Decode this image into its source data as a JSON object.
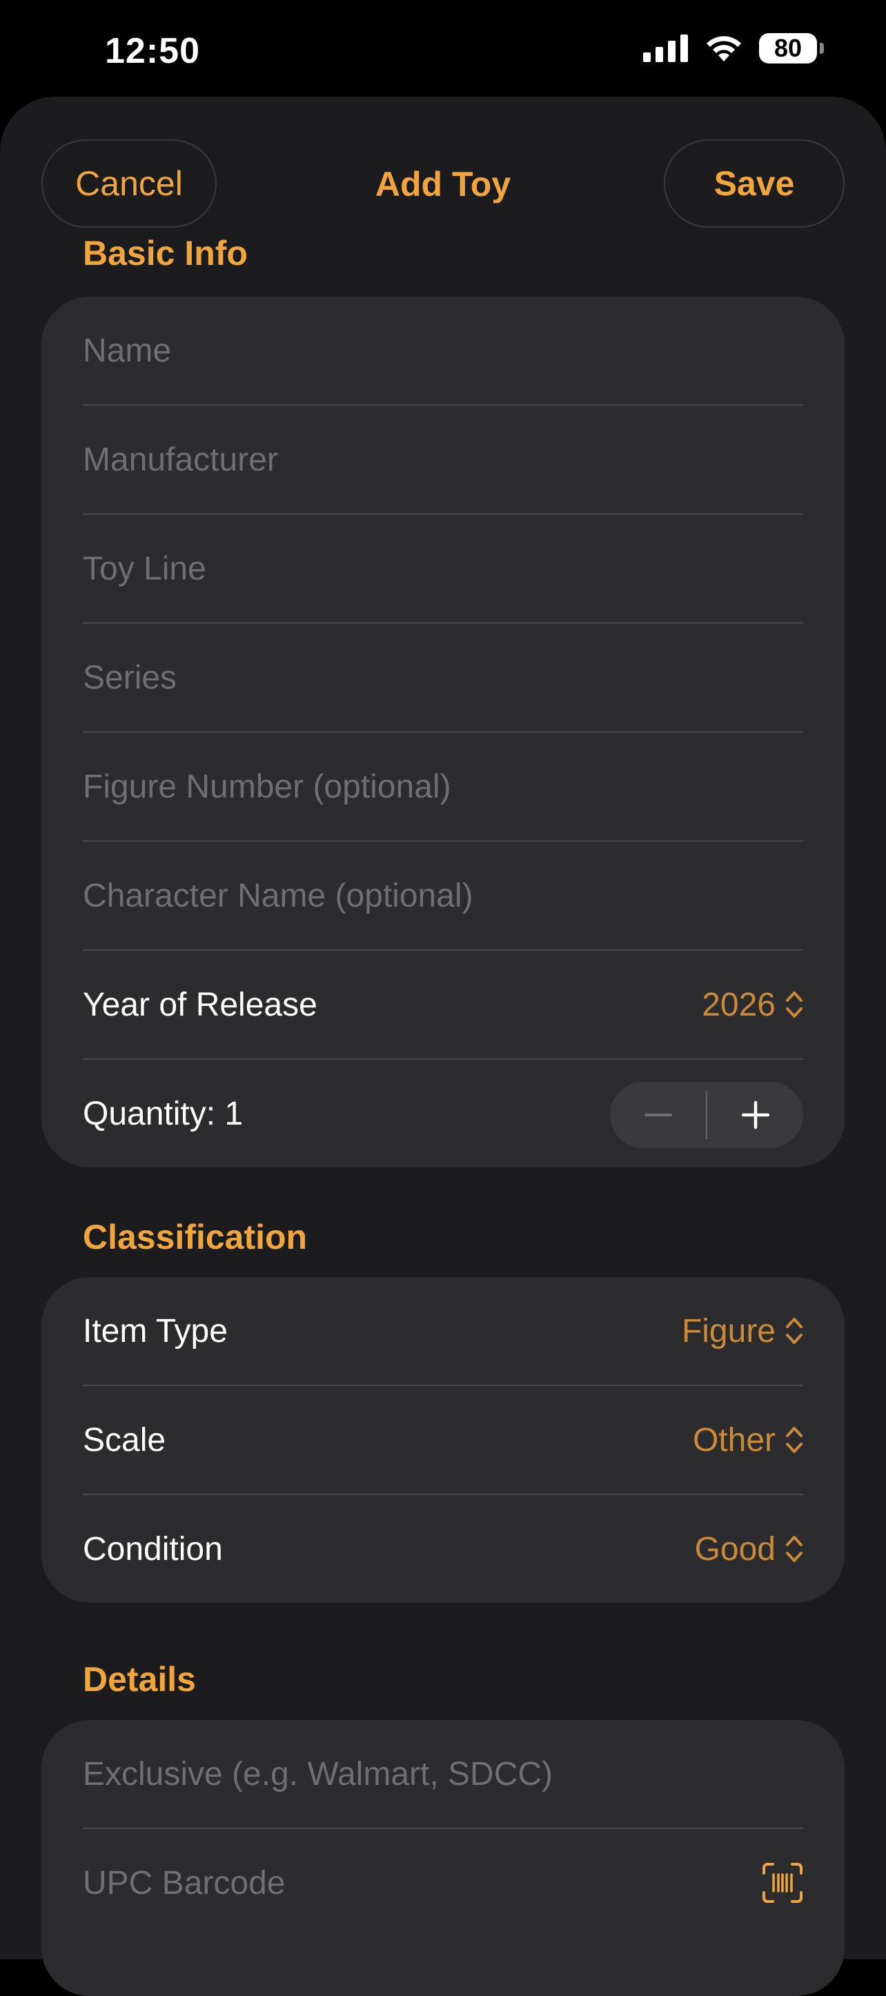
{
  "status": {
    "time": "12:50",
    "battery": "80",
    "icons": [
      "cellular-signal-icon",
      "wifi-icon",
      "battery-icon"
    ]
  },
  "nav": {
    "cancel": "Cancel",
    "title": "Add Toy",
    "save": "Save"
  },
  "basic_info": {
    "header": "Basic Info",
    "name_placeholder": "Name",
    "manufacturer_placeholder": "Manufacturer",
    "toy_line_placeholder": "Toy Line",
    "series_placeholder": "Series",
    "figure_number_placeholder": "Figure Number (optional)",
    "character_name_placeholder": "Character Name (optional)",
    "year_label": "Year of Release",
    "year_value": "2026",
    "quantity_label": "Quantity: 1"
  },
  "classification": {
    "header": "Classification",
    "item_type_label": "Item Type",
    "item_type_value": "Figure",
    "scale_label": "Scale",
    "scale_value": "Other",
    "condition_label": "Condition",
    "condition_value": "Good"
  },
  "details": {
    "header": "Details",
    "exclusive_placeholder": "Exclusive (e.g. Walmart, SDCC)",
    "upc_placeholder": "UPC Barcode"
  },
  "colors": {
    "accent": "#f0a63c",
    "picker_value": "#c98b3a",
    "background": "#1c1c1e",
    "group": "#2c2c2e"
  }
}
